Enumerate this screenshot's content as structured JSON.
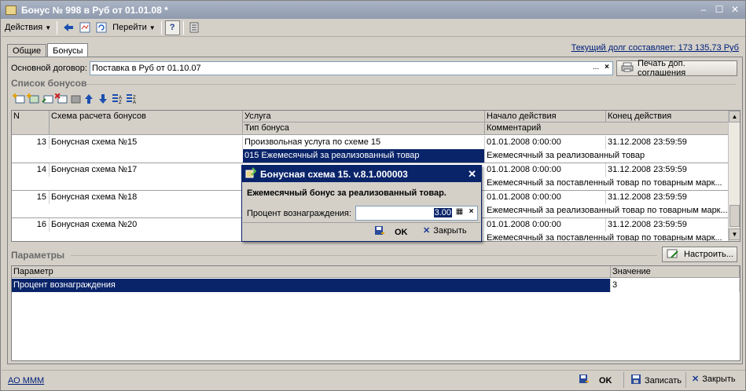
{
  "window": {
    "title": "Бонус № 998 в Руб от 01.01.08 *"
  },
  "menu": {
    "actions_label": "Действия",
    "goto_label": "Перейти",
    "help_label": "?"
  },
  "tabs": [
    {
      "label": "Общие"
    },
    {
      "label": "Бонусы"
    }
  ],
  "debt_link": "Текущий долг составляет: 173 135,73 Руб",
  "contract": {
    "label": "Основной договор:",
    "value": "Поставка в Руб от 01.10.07",
    "select_btn": "...",
    "clear_btn": "×",
    "print_label": "Печать доп. соглашения"
  },
  "bonus_list": {
    "title": "Список бонусов",
    "columns": {
      "n": "N",
      "scheme": "Схема расчета бонусов",
      "service": "Услуга",
      "type": "Тип бонуса",
      "start": "Начало действия",
      "comment": "Комментарий",
      "end": "Конец действия"
    },
    "rows": [
      {
        "n": "13",
        "scheme": "Бонусная схема №15",
        "service": "Произвольная услуга по схеме 15",
        "type": "015 Ежемесячный за реализованный товар",
        "start": "01.01.2008 0:00:00",
        "end": "31.12.2008 23:59:59",
        "comment": "Ежемесячный за реализованный товар"
      },
      {
        "n": "14",
        "scheme": "Бонусная схема №17",
        "service": "",
        "type": "",
        "start": "01.01.2008 0:00:00",
        "end": "31.12.2008 23:59:59",
        "comment": "Ежемесячный за поставленный товар по товарным марк..."
      },
      {
        "n": "15",
        "scheme": "Бонусная схема №18",
        "service": "",
        "type": "",
        "start": "01.01.2008 0:00:00",
        "end": "31.12.2008 23:59:59",
        "comment": "Ежемесячный за реализованный товар по товарным марк..."
      },
      {
        "n": "16",
        "scheme": "Бонусная схема №20",
        "service": "",
        "type": "",
        "start": "01.01.2008 0:00:00",
        "end": "31.12.2008 23:59:59",
        "comment": "Ежемесячный за поставленный товар по товарным марк..."
      }
    ]
  },
  "params": {
    "title": "Параметры",
    "configure_label": "Настроить...",
    "columns": {
      "param": "Параметр",
      "value": "Значение"
    },
    "rows": [
      {
        "param": "Процент вознаграждения",
        "value": "3"
      }
    ]
  },
  "dialog": {
    "title": "Бонусная схема 15. v.8.1.000003",
    "heading": "Ежемесячный бонус за реализованный товар.",
    "field_label": "Процент вознаграждения:",
    "field_value": "3.00",
    "ok_label": "OK",
    "close_label": "Закрыть"
  },
  "footer": {
    "org_link": "АО МММ",
    "ok_label": "OK",
    "save_label": "Записать",
    "close_label": "Закрыть"
  }
}
